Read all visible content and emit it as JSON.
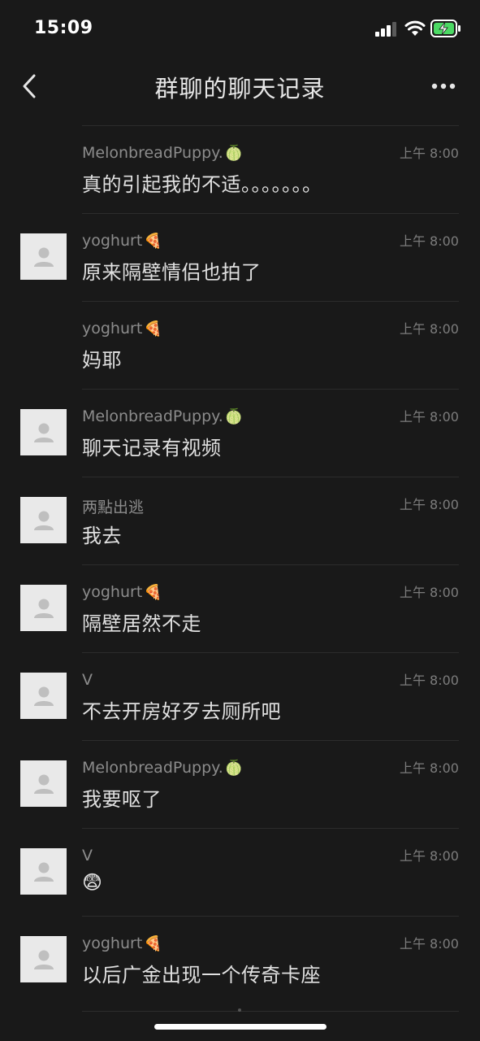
{
  "status_bar": {
    "time": "15:09",
    "signal_icon": "cellular-signal-icon",
    "wifi_icon": "wifi-icon",
    "battery_icon": "battery-charging-icon",
    "battery_color": "#4cd964"
  },
  "nav": {
    "back_icon": "chevron-left-icon",
    "title": "群聊的聊天记录",
    "more_icon": "more-dots-icon"
  },
  "messages": [
    {
      "sender": "MelonbreadPuppy.",
      "sender_emoji": "🍈",
      "time": "上午 8:00",
      "text": "真的引起我的不适。。。。。。。",
      "show_avatar": false
    },
    {
      "sender": "yoghurt",
      "sender_emoji": "🍕",
      "time": "上午 8:00",
      "text": "原来隔壁情侣也拍了",
      "show_avatar": true
    },
    {
      "sender": "yoghurt",
      "sender_emoji": "🍕",
      "time": "上午 8:00",
      "text": "妈耶",
      "show_avatar": false
    },
    {
      "sender": "MelonbreadPuppy.",
      "sender_emoji": "🍈",
      "time": "上午 8:00",
      "text": "聊天记录有视频",
      "show_avatar": true
    },
    {
      "sender": "两點出逃",
      "sender_emoji": "",
      "time": "上午 8:00",
      "text": "我去",
      "show_avatar": true
    },
    {
      "sender": "yoghurt",
      "sender_emoji": "🍕",
      "time": "上午 8:00",
      "text": "隔壁居然不走",
      "show_avatar": true
    },
    {
      "sender": "V",
      "sender_emoji": "",
      "time": "上午 8:00",
      "text": "不去开房好歹去厕所吧",
      "show_avatar": true
    },
    {
      "sender": "MelonbreadPuppy.",
      "sender_emoji": "🍈",
      "time": "上午 8:00",
      "text": "我要呕了",
      "show_avatar": true
    },
    {
      "sender": "V",
      "sender_emoji": "",
      "time": "上午 8:00",
      "text": "😨",
      "show_avatar": true
    },
    {
      "sender": "yoghurt",
      "sender_emoji": "🍕",
      "time": "上午 8:00",
      "text": "以后广金出现一个传奇卡座",
      "show_avatar": true
    }
  ],
  "avatar_icon": "default-person-icon"
}
